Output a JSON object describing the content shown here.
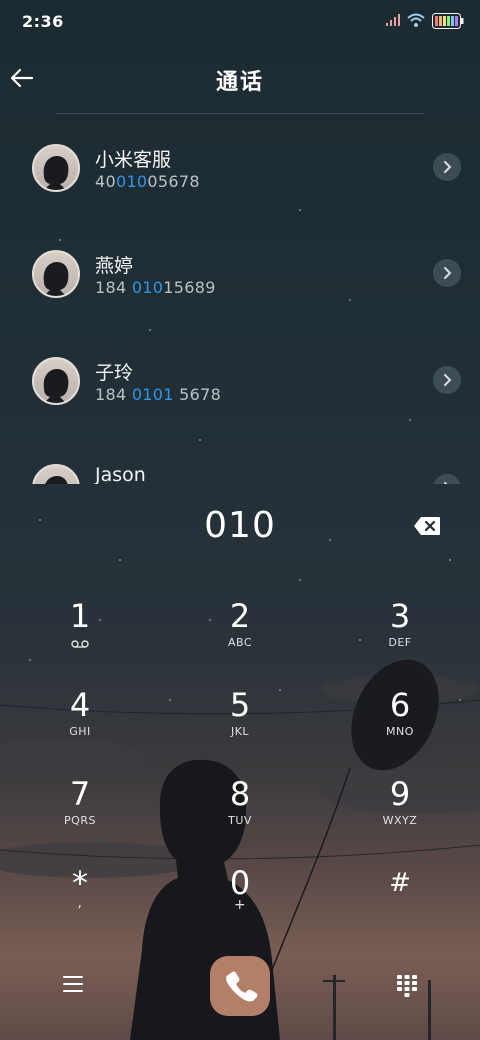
{
  "status_bar": {
    "time": "2:36"
  },
  "header": {
    "title": "通话"
  },
  "contacts": [
    {
      "name": "小米客服",
      "number_pre": "40",
      "number_match": "010",
      "number_post": "05678"
    },
    {
      "name": "燕婷",
      "number_pre": "184 ",
      "number_match": "010",
      "number_post": "15689"
    },
    {
      "name": "子玲",
      "number_pre": "184 ",
      "number_match": "0101",
      "number_post": " 5678"
    },
    {
      "name": "Jason",
      "number_pre": "",
      "number_match": "",
      "number_post": ""
    }
  ],
  "dialer": {
    "entry": "010",
    "keys": [
      {
        "digit": "1",
        "letters": ""
      },
      {
        "digit": "2",
        "letters": "ABC"
      },
      {
        "digit": "3",
        "letters": "DEF"
      },
      {
        "digit": "4",
        "letters": "GHI"
      },
      {
        "digit": "5",
        "letters": "JKL"
      },
      {
        "digit": "6",
        "letters": "MNO"
      },
      {
        "digit": "7",
        "letters": "PQRS"
      },
      {
        "digit": "8",
        "letters": "TUV"
      },
      {
        "digit": "9",
        "letters": "WXYZ"
      },
      {
        "digit": "*",
        "letters": ","
      },
      {
        "digit": "0",
        "letters": "+"
      },
      {
        "digit": "#",
        "letters": ""
      }
    ]
  },
  "colors": {
    "highlight": "#2f95e8",
    "call_button": "#b47f69"
  },
  "icons": {
    "back": "arrow-left-icon",
    "chevron": "chevron-right-icon",
    "backspace": "backspace-icon",
    "voicemail": "voicemail-icon",
    "menu": "menu-icon",
    "call": "phone-icon",
    "keypad": "keypad-icon"
  }
}
